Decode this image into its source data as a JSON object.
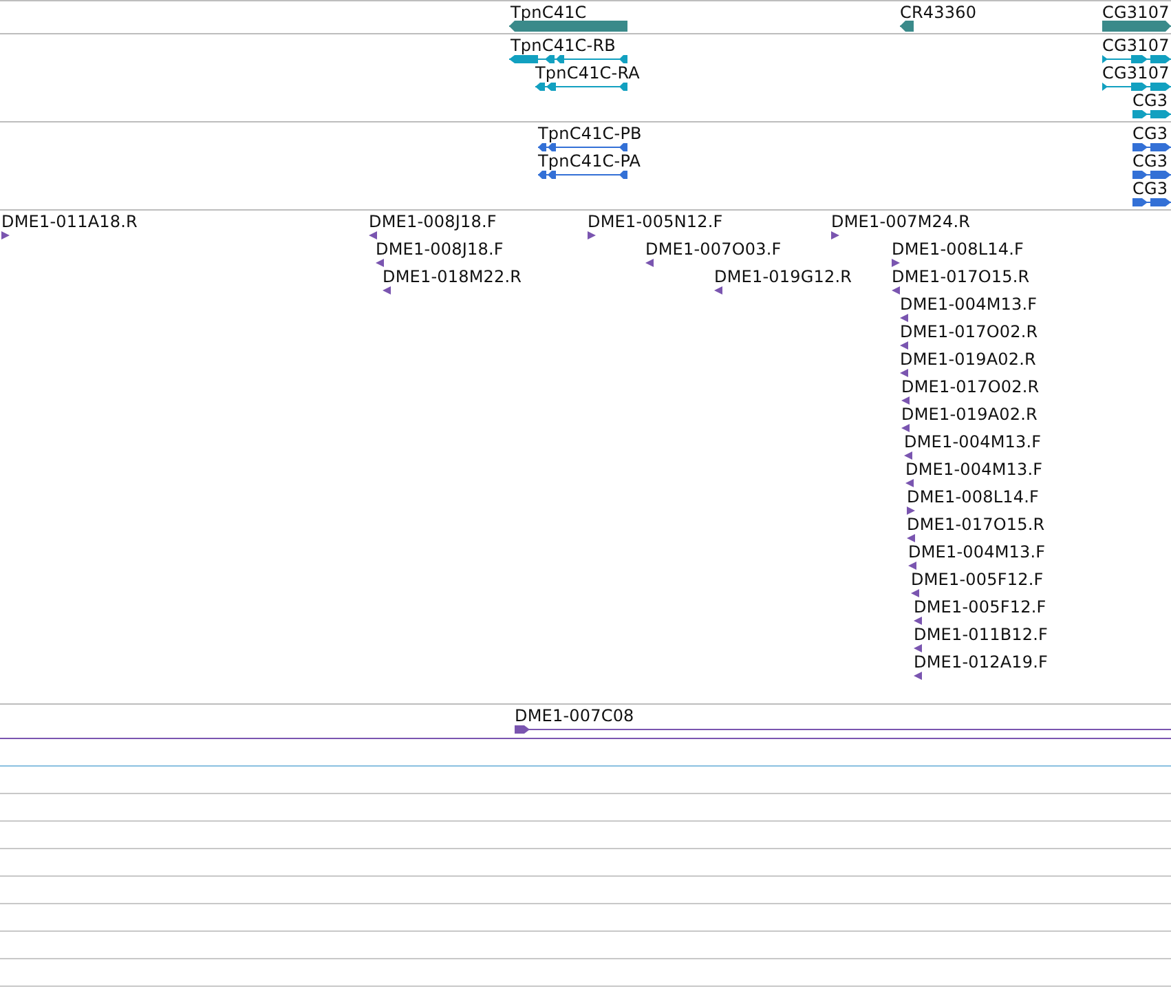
{
  "tracks": [
    {
      "kind": "gene",
      "features": [
        {
          "label": "TpnC41C",
          "reverse": true
        },
        {
          "label": "CR43360",
          "reverse": true
        },
        {
          "label": "CG3107",
          "reverse": false
        }
      ]
    },
    {
      "kind": "transcript",
      "features": [
        {
          "label": "TpnC41C-RB",
          "reverse": true
        },
        {
          "label": "TpnC41C-RA",
          "reverse": true
        },
        {
          "label": "CG3107",
          "reverse": false
        },
        {
          "label": "CG3107",
          "reverse": false
        },
        {
          "label": "CG3",
          "reverse": false
        }
      ]
    },
    {
      "kind": "protein",
      "features": [
        {
          "label": "TpnC41C-PB",
          "reverse": true
        },
        {
          "label": "TpnC41C-PA",
          "reverse": true
        },
        {
          "label": "CG3",
          "reverse": false
        },
        {
          "label": "CG3",
          "reverse": false
        },
        {
          "label": "CG3",
          "reverse": false
        }
      ]
    },
    {
      "kind": "est",
      "features": [
        {
          "label": "DME1-011A18.R",
          "reverse": false
        },
        {
          "label": "DME1-008J18.F",
          "reverse": true
        },
        {
          "label": "DME1-008J18.F",
          "reverse": true
        },
        {
          "label": "DME1-018M22.R",
          "reverse": true
        },
        {
          "label": "DME1-005N12.F",
          "reverse": false
        },
        {
          "label": "DME1-007O03.F",
          "reverse": true
        },
        {
          "label": "DME1-019G12.R",
          "reverse": true
        },
        {
          "label": "DME1-007M24.R",
          "reverse": false
        },
        {
          "label": "DME1-008L14.F",
          "reverse": false
        },
        {
          "label": "DME1-017O15.R",
          "reverse": true
        },
        {
          "label": "DME1-004M13.F",
          "reverse": true
        },
        {
          "label": "DME1-017O02.R",
          "reverse": true
        },
        {
          "label": "DME1-019A02.R",
          "reverse": true
        },
        {
          "label": "DME1-017O02.R",
          "reverse": true
        },
        {
          "label": "DME1-019A02.R",
          "reverse": true
        },
        {
          "label": "DME1-004M13.F",
          "reverse": true
        },
        {
          "label": "DME1-004M13.F",
          "reverse": true
        },
        {
          "label": "DME1-008L14.F",
          "reverse": false
        },
        {
          "label": "DME1-017O15.R",
          "reverse": true
        },
        {
          "label": "DME1-004M13.F",
          "reverse": true
        },
        {
          "label": "DME1-005F12.F",
          "reverse": true
        },
        {
          "label": "DME1-005F12.F",
          "reverse": true
        },
        {
          "label": "DME1-011B12.F",
          "reverse": true
        },
        {
          "label": "DME1-012A19.F",
          "reverse": true
        }
      ]
    },
    {
      "kind": "clone",
      "features": [
        {
          "label": "DME1-007C08",
          "reverse": false
        }
      ]
    }
  ]
}
